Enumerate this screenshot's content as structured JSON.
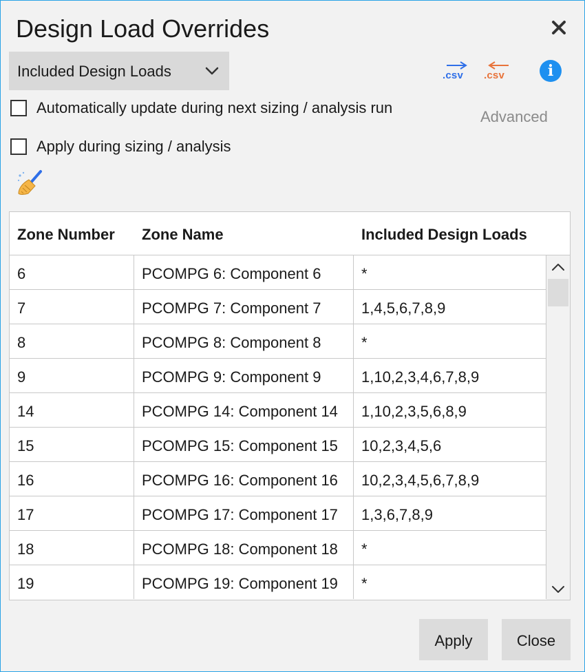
{
  "window": {
    "title": "Design Load Overrides",
    "close_icon": "close-icon"
  },
  "toolbar": {
    "dropdown": {
      "selected": "Included Design Loads",
      "icon": "chevron-down-icon"
    },
    "export_csv": {
      "label": ".csv",
      "icon": "arrow-right-icon",
      "color": "#2f6fe8"
    },
    "import_csv": {
      "label": ".csv",
      "icon": "arrow-left-icon",
      "color": "#e8733a"
    },
    "info": {
      "label": "i",
      "icon": "info-icon",
      "color": "#1e90f0"
    },
    "advanced_label": "Advanced",
    "clear_icon": "broom-icon"
  },
  "options": {
    "auto_update": {
      "label": "Automatically update during next sizing / analysis run",
      "checked": false
    },
    "apply_during": {
      "label": "Apply during sizing / analysis",
      "checked": false
    }
  },
  "table": {
    "headers": [
      "Zone Number",
      "Zone Name",
      "Included Design Loads"
    ],
    "rows": [
      [
        "6",
        "PCOMPG 6: Component 6",
        "*"
      ],
      [
        "7",
        "PCOMPG 7: Component 7",
        "1,4,5,6,7,8,9"
      ],
      [
        "8",
        "PCOMPG 8: Component 8",
        "*"
      ],
      [
        "9",
        "PCOMPG 9: Component 9",
        "1,10,2,3,4,6,7,8,9"
      ],
      [
        "14",
        "PCOMPG 14: Component 14",
        "1,10,2,3,5,6,8,9"
      ],
      [
        "15",
        "PCOMPG 15: Component 15",
        "10,2,3,4,5,6"
      ],
      [
        "16",
        "PCOMPG 16: Component 16",
        "10,2,3,4,5,6,7,8,9"
      ],
      [
        "17",
        "PCOMPG 17: Component 17",
        "1,3,6,7,8,9"
      ],
      [
        "18",
        "PCOMPG 18: Component 18",
        "*"
      ],
      [
        "19",
        "PCOMPG 19: Component 19",
        "*"
      ]
    ]
  },
  "buttons": {
    "apply": "Apply",
    "close": "Close"
  }
}
